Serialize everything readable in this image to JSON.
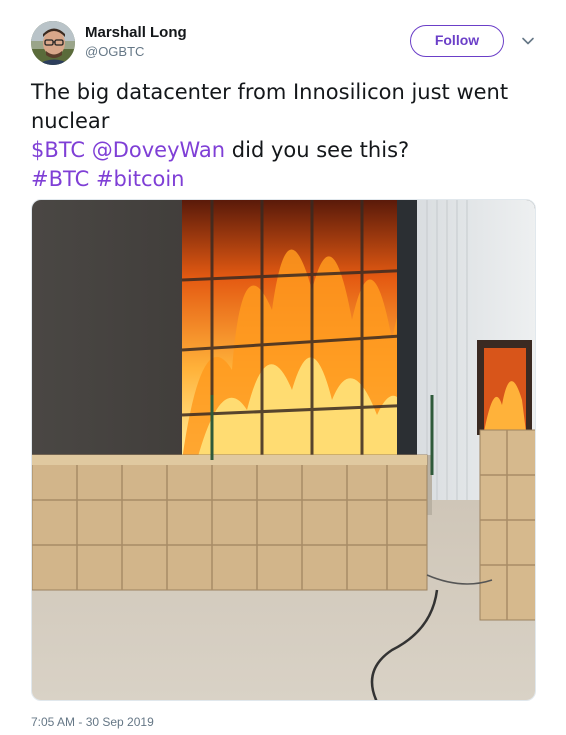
{
  "author": {
    "name": "Marshall Long",
    "handle": "@OGBTC"
  },
  "follow_button": {
    "label": "Follow"
  },
  "tweet": {
    "line1": "The big datacenter from Innosilicon just went",
    "line2": "nuclear",
    "cashtag": "$BTC",
    "mention": "@DoveyWan",
    "line3_rest": " did you see this?",
    "hashtag1": "#BTC",
    "hashtag2": "#bitcoin"
  },
  "timestamp": "7:05 AM - 30 Sep 2019",
  "colors": {
    "link": "#7f3fd6",
    "follow_border": "#6b3fc8",
    "secondary_text": "#657786"
  },
  "icons": {
    "caret": "chevron-down-icon"
  }
}
